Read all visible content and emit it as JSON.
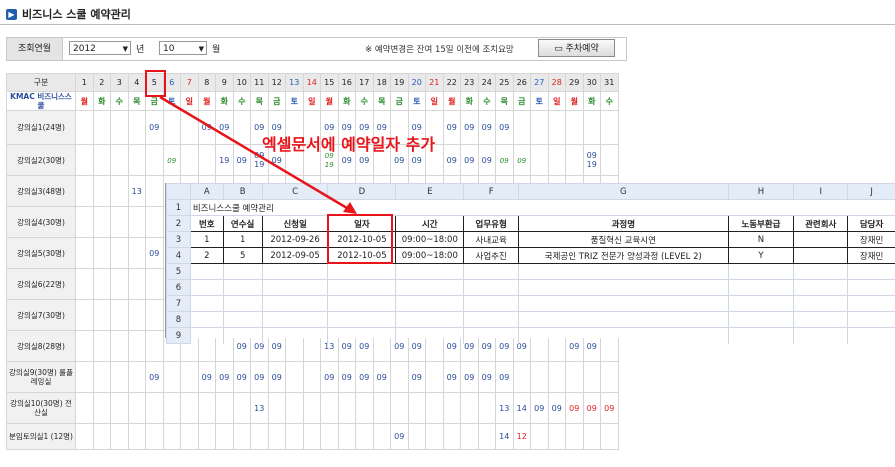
{
  "page": {
    "title": "비즈니스 스쿨 예약관리"
  },
  "filter": {
    "label": "조회연월",
    "year": "2012",
    "year_unit": "년",
    "month": "10",
    "month_unit": "월",
    "notice": "※ 예약변경은 잔여 15일 이전에 조치요망",
    "button": "주차예약"
  },
  "calendar": {
    "corner": "구분",
    "org": "KMAC 비즈니스스쿨",
    "days": [
      "1",
      "2",
      "3",
      "4",
      "5",
      "6",
      "7",
      "8",
      "9",
      "10",
      "11",
      "12",
      "13",
      "14",
      "15",
      "16",
      "17",
      "18",
      "19",
      "20",
      "21",
      "22",
      "23",
      "24",
      "25",
      "26",
      "27",
      "28",
      "29",
      "30",
      "31"
    ],
    "weekdays": [
      "월",
      "화",
      "수",
      "목",
      "금",
      "토",
      "일",
      "월",
      "화",
      "수",
      "목",
      "금",
      "토",
      "일",
      "월",
      "화",
      "수",
      "목",
      "금",
      "토",
      "일",
      "월",
      "화",
      "수",
      "목",
      "금",
      "토",
      "일",
      "월",
      "화",
      "수"
    ],
    "rooms": [
      {
        "name": "강의실1(24명)",
        "cells": {
          "5": "09",
          "8": "09",
          "9": "09",
          "11": "09",
          "12": "09",
          "15": "09",
          "16": "09",
          "17": "09",
          "18": "09",
          "20": "09",
          "22": "09",
          "23": "09",
          "24": "09",
          "25": "09"
        }
      },
      {
        "name": "강의실2(30명)",
        "cells": {
          "6": "09",
          "9": "19",
          "10": "09",
          "11": "09 19",
          "12": "09",
          "15": "09 19",
          "16": "09",
          "17": "09",
          "19": "09",
          "20": "09",
          "22": "09",
          "23": "09",
          "24": "09",
          "25": "09",
          "26": "09",
          "30": "09 19"
        },
        "green": [
          "6",
          "15",
          "25",
          "26"
        ]
      },
      {
        "name": "강의실3(48명)",
        "cells": {
          "4": "13"
        }
      },
      {
        "name": "강의실4(30명)",
        "cells": {}
      },
      {
        "name": "강의실5(30명)",
        "cells": {
          "5": "09"
        }
      },
      {
        "name": "강의실6(22명)",
        "cells": {}
      },
      {
        "name": "강의실7(30명)",
        "cells": {}
      },
      {
        "name": "강의실8(28명)",
        "cells": {
          "10": "09",
          "11": "09",
          "12": "09",
          "15": "13",
          "16": "09",
          "17": "09",
          "19": "09",
          "20": "09",
          "22": "09",
          "23": "09",
          "24": "09",
          "25": "09",
          "26": "09",
          "29": "09",
          "30": "09"
        }
      },
      {
        "name": "강의실9(30명) 룰플레잉실",
        "cells": {
          "5": "09",
          "8": "09",
          "9": "09",
          "10": "09",
          "11": "09",
          "12": "09",
          "15": "09",
          "16": "09",
          "17": "09",
          "18": "09",
          "20": "09",
          "22": "09",
          "23": "09",
          "24": "09",
          "25": "09"
        }
      },
      {
        "name": "강의실10(30명) 전산실",
        "cells": {
          "11": "13",
          "25": "13",
          "26": "14",
          "27": "09",
          "28": "09",
          "29": "09",
          "30": "09",
          "31": "09"
        },
        "red": [
          "29",
          "30",
          "31"
        ]
      },
      {
        "name": "분임토의실1 (12명)",
        "cells": {
          "19": "09",
          "25": "14",
          "26": "12"
        },
        "red": [
          "26"
        ]
      }
    ]
  },
  "excel": {
    "columns": [
      "A",
      "B",
      "C",
      "D",
      "E",
      "F",
      "G",
      "H",
      "I",
      "J"
    ],
    "row_numbers": [
      "1",
      "2",
      "3",
      "4",
      "5",
      "6",
      "7",
      "8",
      "9"
    ],
    "title": "비즈니스스쿨 예약관리",
    "headers": [
      "번호",
      "연수실",
      "신청일",
      "일자",
      "시간",
      "업무유형",
      "과정명",
      "노동부환급",
      "관련회사",
      "담당자"
    ],
    "rows": [
      [
        "1",
        "1",
        "2012-09-26",
        "2012-10-05",
        "09:00~18:00",
        "사내교육",
        "품질혁신 교육시연",
        "N",
        "",
        "장재민"
      ],
      [
        "2",
        "5",
        "2012-09-05",
        "2012-10-05",
        "09:00~18:00",
        "사업추진",
        "국제공인 TRIZ 전문가 양성과정 (LEVEL 2)",
        "Y",
        "",
        "장재민"
      ]
    ]
  },
  "annotation": {
    "text": "엑셀문서에 예약일자 추가"
  },
  "colors": {
    "accent": "#e8141a",
    "icon": "#1f5fae"
  }
}
